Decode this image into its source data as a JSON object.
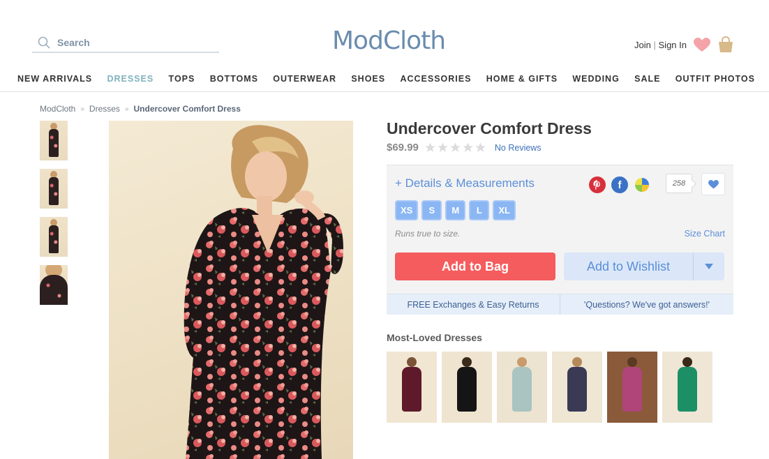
{
  "header": {
    "search_placeholder": "Search",
    "logo": "ModCloth",
    "join": "Join",
    "signin": "Sign In",
    "brand_color": "#6a8caf"
  },
  "nav": {
    "items": [
      {
        "label": "NEW ARRIVALS"
      },
      {
        "label": "DRESSES"
      },
      {
        "label": "TOPS"
      },
      {
        "label": "BOTTOMS"
      },
      {
        "label": "OUTERWEAR"
      },
      {
        "label": "SHOES"
      },
      {
        "label": "ACCESSORIES"
      },
      {
        "label": "HOME & GIFTS"
      },
      {
        "label": "WEDDING"
      },
      {
        "label": "SALE"
      },
      {
        "label": "OUTFIT PHOTOS"
      }
    ],
    "active": "DRESSES",
    "active_color": "#7fb2bb"
  },
  "breadcrumb": {
    "items": [
      "ModCloth",
      "Dresses"
    ],
    "separator": "»",
    "current": "Undercover Comfort Dress"
  },
  "product": {
    "title": "Undercover Comfort Dress",
    "price": "$69.99",
    "rating": 0,
    "reviews_label": "No Reviews",
    "details_label": "+ Details & Measurements",
    "share_count": "258",
    "sizes": [
      "XS",
      "S",
      "M",
      "L",
      "XL"
    ],
    "fit_note": "Runs true to size.",
    "size_chart_label": "Size Chart",
    "add_to_bag_label": "Add to Bag",
    "add_to_wishlist_label": "Add to Wishlist",
    "free_exchanges_label": "FREE Exchanges & Easy Returns",
    "questions_label": "'Questions? We've got answers!'",
    "accent_red": "#f55c5e",
    "accent_blue": "#5b8fd8"
  },
  "most_loved": {
    "title": "Most-Loved Dresses"
  }
}
